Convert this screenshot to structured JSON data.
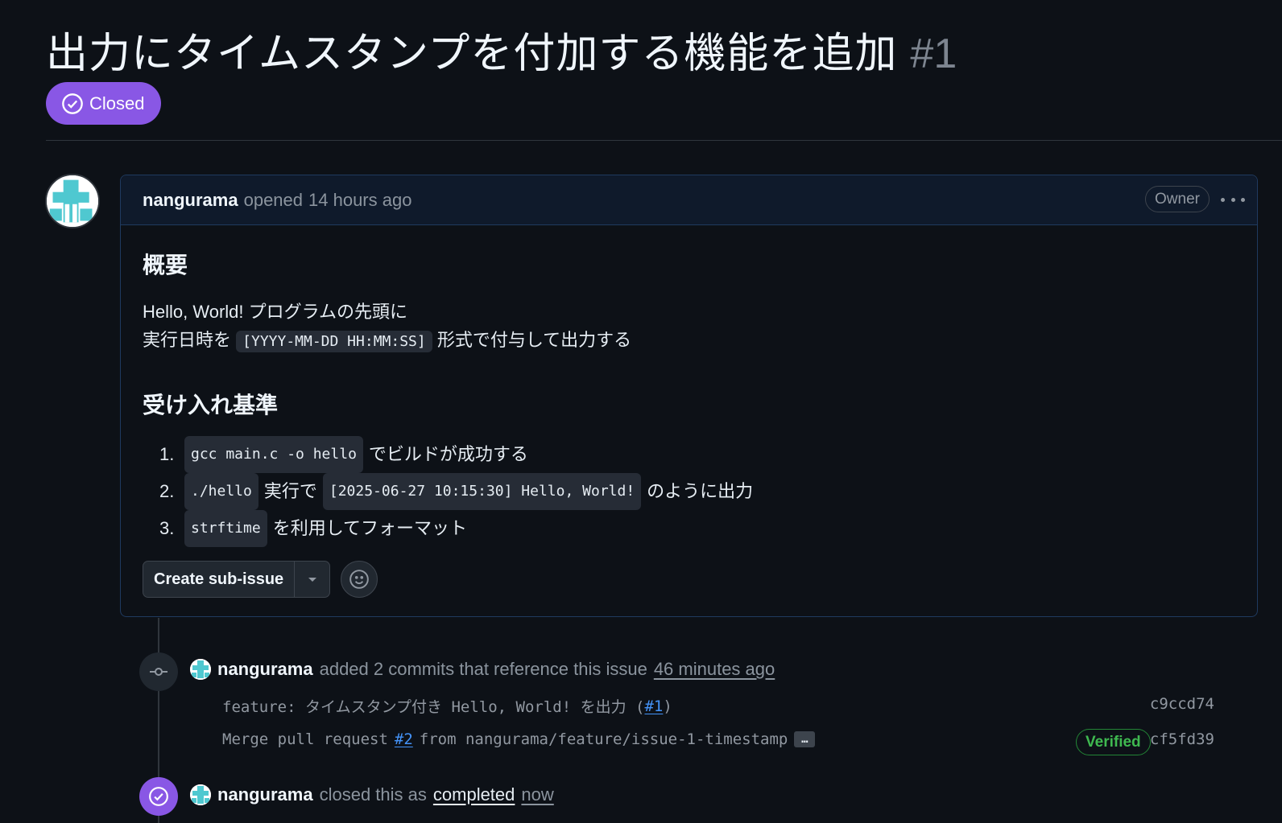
{
  "issue": {
    "title": "出力にタイムスタンプを付加する機能を追加",
    "number": "#1",
    "state": "Closed"
  },
  "comment": {
    "author": "nangurama",
    "action": "opened",
    "time": "14 hours ago",
    "role_badge": "Owner",
    "heading_summary": "概要",
    "summary_line1": "Hello, World! プログラムの先頭に",
    "summary_line2_prefix": "実行日時を",
    "summary_line2_code": "[YYYY-MM-DD HH:MM:SS]",
    "summary_line2_suffix": "形式で付与して出力する",
    "heading_acceptance": "受け入れ基準",
    "criteria": [
      {
        "num": "1.",
        "code1": "gcc main.c -o hello",
        "text1": "でビルドが成功する",
        "code2": "",
        "text2": ""
      },
      {
        "num": "2.",
        "code1": "./hello",
        "text1": "実行で",
        "code2": "[2025-06-27 10:15:30] Hello, World!",
        "text2": "のように出力"
      },
      {
        "num": "3.",
        "code1": "strftime",
        "text1": "を利用してフォーマット",
        "code2": "",
        "text2": ""
      }
    ],
    "create_sub_issue_label": "Create sub-issue"
  },
  "timeline": {
    "commits_event": {
      "author": "nangurama",
      "text": "added 2 commits that reference this issue",
      "time": "46 minutes ago"
    },
    "commits": [
      {
        "message_prefix": "feature: タイムスタンプ付き Hello, World! を出力 (",
        "link": "#1",
        "message_suffix": ")",
        "sha": "c9ccd74"
      },
      {
        "message_prefix": "Merge pull request",
        "link": "#2",
        "message_suffix": "from nangurama/feature/issue-1-timestamp",
        "ellipsis": "…",
        "badge": "Verified",
        "sha": "cf5fd39"
      }
    ],
    "closed_event": {
      "author": "nangurama",
      "text": "closed this as",
      "reason": "completed",
      "time": "now"
    }
  },
  "colors": {
    "background": "#0d1117",
    "closed_purple": "#8957e5",
    "link_blue": "#4493f8",
    "verified_green": "#3fb950",
    "avatar_teal": "#4fc8d0"
  }
}
